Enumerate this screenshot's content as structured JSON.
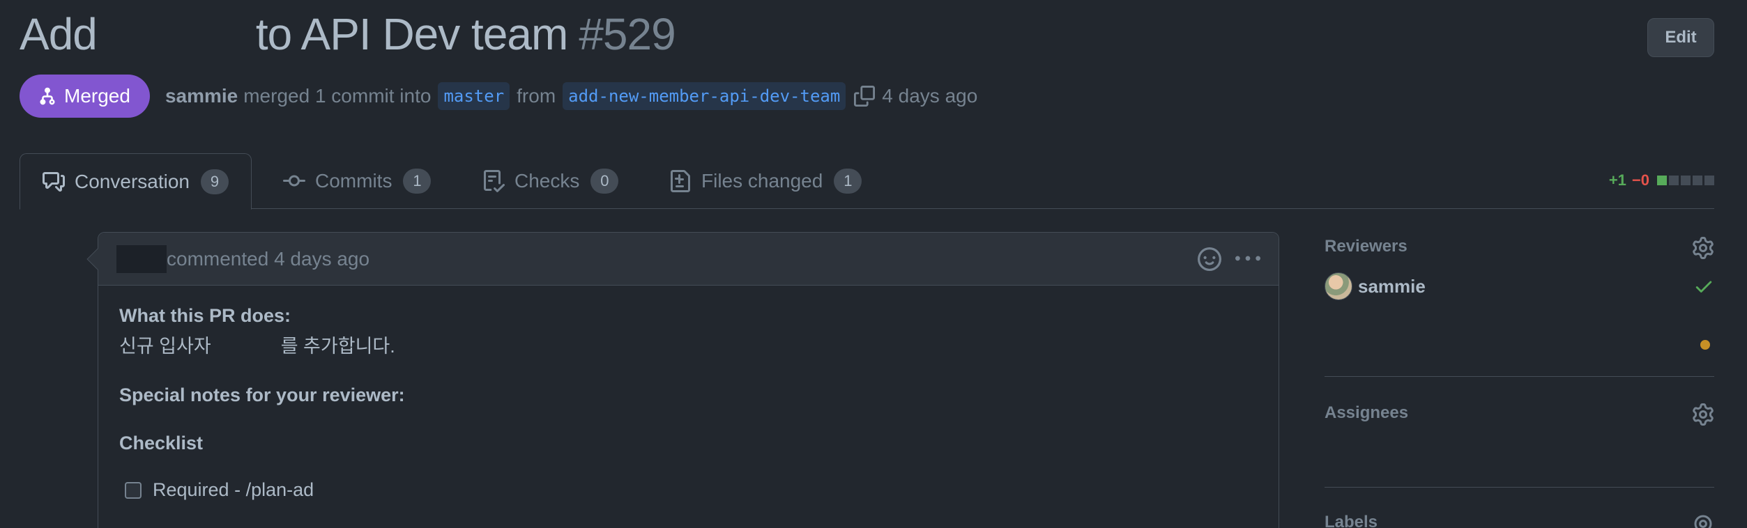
{
  "pr": {
    "title_part1": "Add",
    "title_part2": "to API Dev team",
    "number": "#529",
    "edit_label": "Edit",
    "state_label": "Merged",
    "author": "sammie",
    "merge_text": "merged 1 commit into",
    "base_branch": "master",
    "from_text": "from",
    "head_branch": "add-new-member-api-dev-team",
    "time": "4 days ago"
  },
  "tabs": [
    {
      "label": "Conversation",
      "count": "9",
      "icon": "comment-discussion-icon"
    },
    {
      "label": "Commits",
      "count": "1",
      "icon": "git-commit-icon"
    },
    {
      "label": "Checks",
      "count": "0",
      "icon": "checklist-icon"
    },
    {
      "label": "Files changed",
      "count": "1",
      "icon": "file-diff-icon"
    }
  ],
  "diffstat": {
    "additions": "+1",
    "deletions": "−0"
  },
  "comment": {
    "header_text": "commented 4 days ago",
    "what_heading": "What this PR does:",
    "what_line_part1": "신규 입사자",
    "what_line_part2": "를 추가합니다.",
    "notes_heading": "Special notes for your reviewer:",
    "checklist_heading": "Checklist",
    "checklist_items": [
      "Required - /plan-ad"
    ]
  },
  "sidebar": {
    "reviewers_title": "Reviewers",
    "reviewers": [
      {
        "name": "sammie",
        "status": "approved"
      }
    ],
    "assignees_title": "Assignees",
    "labels_title": "Labels"
  },
  "colors": {
    "background": "#22272e",
    "merged": "#8256d0",
    "accent_blue": "#539bf5",
    "additions": "#57ab5a",
    "deletions": "#e5534b",
    "pending": "#c69026"
  }
}
